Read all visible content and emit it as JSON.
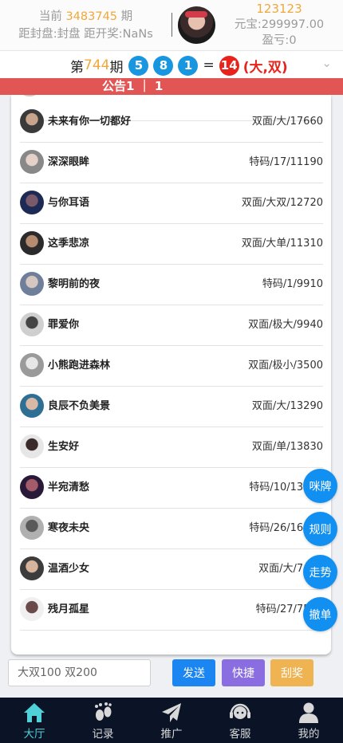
{
  "header": {
    "period_prefix": "当前",
    "period_number": "3483745",
    "period_suffix": "期",
    "countdown": "距封盘:封盘 距开奖:NaNs",
    "user_id": "123123",
    "balance": "元宝:299997.00",
    "profit": "盈亏:0"
  },
  "result": {
    "prefix": "第",
    "period": "744",
    "suffix": "期",
    "balls": [
      "5",
      "8",
      "1"
    ],
    "equals": "=",
    "sum": "14",
    "tag": "(大,双)",
    "colors": {
      "ball_blue": "#1896e0",
      "ball_red": "#e8231c"
    }
  },
  "notice": {
    "text": "公告1 ｜ 1"
  },
  "bets": [
    {
      "name": "未来有你一切都好",
      "bet": "双面/大/17660"
    },
    {
      "name": "深深眼眸",
      "bet": "特码/17/11190"
    },
    {
      "name": "与你耳语",
      "bet": "双面/大双/12720"
    },
    {
      "name": "这季悲凉",
      "bet": "双面/大单/11310"
    },
    {
      "name": "黎明前的夜",
      "bet": "特码/1/9910"
    },
    {
      "name": "罪爱你",
      "bet": "双面/极大/9940"
    },
    {
      "name": "小熊跑进森林",
      "bet": "双面/极小/3500"
    },
    {
      "name": "良辰不负美景",
      "bet": "双面/大/13290"
    },
    {
      "name": "生安好",
      "bet": "双面/单/13830"
    },
    {
      "name": "半宛清愁",
      "bet": "特码/10/13220"
    },
    {
      "name": "寒夜未央",
      "bet": "特码/26/16040"
    },
    {
      "name": "温酒少女",
      "bet": "双面/大/7480"
    },
    {
      "name": "残月孤星",
      "bet": "特码/27/7530"
    }
  ],
  "float_buttons": [
    "咪牌",
    "规则",
    "走势",
    "撤单"
  ],
  "input": {
    "placeholder": "大双100 双200"
  },
  "actions": {
    "send": "发送",
    "quick": "快捷",
    "scratch": "刮奖",
    "colors": {
      "send": "#1b86f2",
      "quick": "#8a6de0",
      "scratch": "#f0b352"
    }
  },
  "nav": [
    {
      "label": "大厅",
      "icon": "home-icon",
      "active": true
    },
    {
      "label": "记录",
      "icon": "footprint-icon",
      "active": false
    },
    {
      "label": "推广",
      "icon": "paper-plane-icon",
      "active": false
    },
    {
      "label": "客服",
      "icon": "headset-icon",
      "active": false
    },
    {
      "label": "我的",
      "icon": "user-icon",
      "active": false
    }
  ]
}
